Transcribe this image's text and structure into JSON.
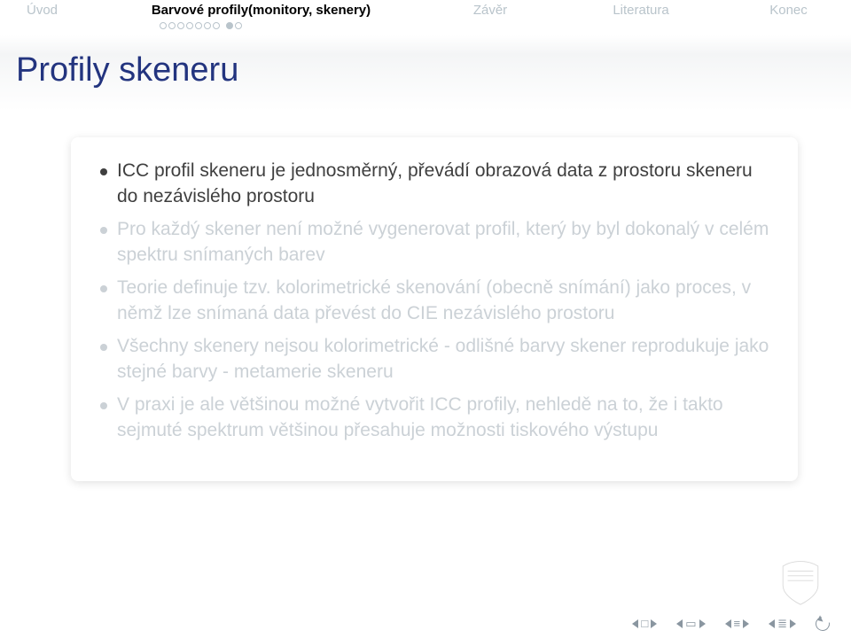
{
  "nav": {
    "uvod": "Úvod",
    "barvove": "Barvové profily(monitory, skenery)",
    "zaver": "Závěr",
    "literatura": "Literatura",
    "konec": "Konec"
  },
  "progress": {
    "group1": [
      false,
      false,
      false,
      false,
      false,
      false,
      false
    ],
    "group2": [
      true,
      false
    ]
  },
  "title": "Profily skeneru",
  "bullets": [
    {
      "text": "ICC profil skeneru je jednosměrný, převádí obrazová data z prostoru skeneru do nezávislého prostoru",
      "visible": true
    },
    {
      "text": "Pro každý skener není možné vygenerovat profil, který by byl dokonalý v celém spektru snímaných barev",
      "visible": false
    },
    {
      "text": "Teorie definuje tzv. kolorimetrické skenování (obecně snímání) jako proces, v němž lze snímaná data převést do CIE nezávislého prostoru",
      "visible": false
    },
    {
      "text": "Všechny skenery nejsou kolorimetrické - odlišné barvy skener reprodukuje jako stejné barvy - metamerie skeneru",
      "visible": false
    },
    {
      "text": "V praxi je ale většinou možné vytvořit ICC profily, nehledě na to, že i takto sejmuté spektrum většinou přesahuje možnosti tiskového výstupu",
      "visible": false
    }
  ],
  "footer_icons": {
    "slide_prev": "slide-prev",
    "slide_next": "slide-next",
    "frame_prev": "frame-prev",
    "frame_next": "frame-next",
    "section_prev": "section-prev",
    "section_next": "section-next",
    "subsection_prev": "subsection-prev",
    "subsection_next": "subsection-next",
    "back": "back-button"
  }
}
